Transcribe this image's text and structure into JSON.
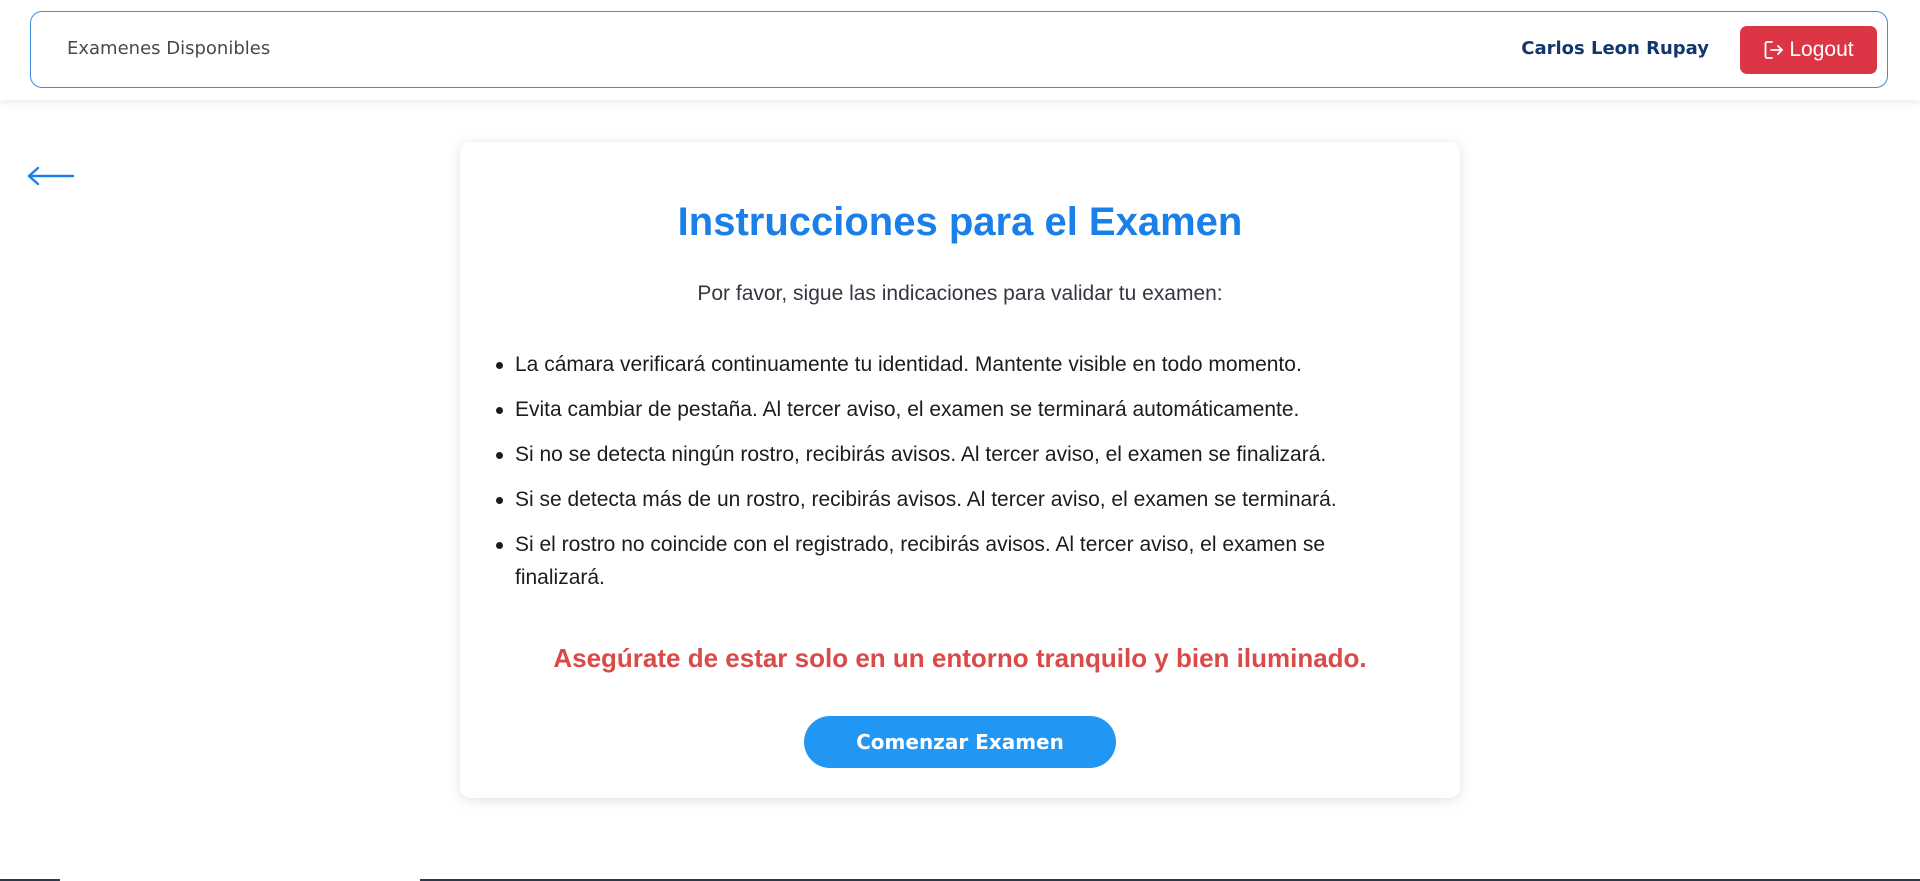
{
  "navbar": {
    "brand": "Examenes Disponibles",
    "user_name": "Carlos Leon Rupay",
    "logout_label": "Logout",
    "logout_icon": "logout-icon"
  },
  "back": {
    "icon": "arrow-left-icon"
  },
  "card": {
    "title": "Instrucciones para el Examen",
    "subtitle": "Por favor, sigue las indicaciones para validar tu examen:",
    "rules": [
      "La cámara verificará continuamente tu identidad. Mantente visible en todo momento.",
      "Evita cambiar de pestaña. Al tercer aviso, el examen se terminará automáticamente.",
      "Si no se detecta ningún rostro, recibirás avisos. Al tercer aviso, el examen se finalizará.",
      "Si se detecta más de un rostro, recibirás avisos. Al tercer aviso, el examen se terminará.",
      "Si el rostro no coincide con el registrado, recibirás avisos. Al tercer aviso, el examen se finalizará."
    ],
    "warning": "Asegúrate de estar solo en un entorno tranquilo y bien iluminado.",
    "start_button": "Comenzar Examen"
  },
  "colors": {
    "accent_blue": "#1a7fe8",
    "button_blue": "#2196f3",
    "danger_red": "#dc3545",
    "warning_red": "#d94a48",
    "user_navy": "#13366e"
  }
}
